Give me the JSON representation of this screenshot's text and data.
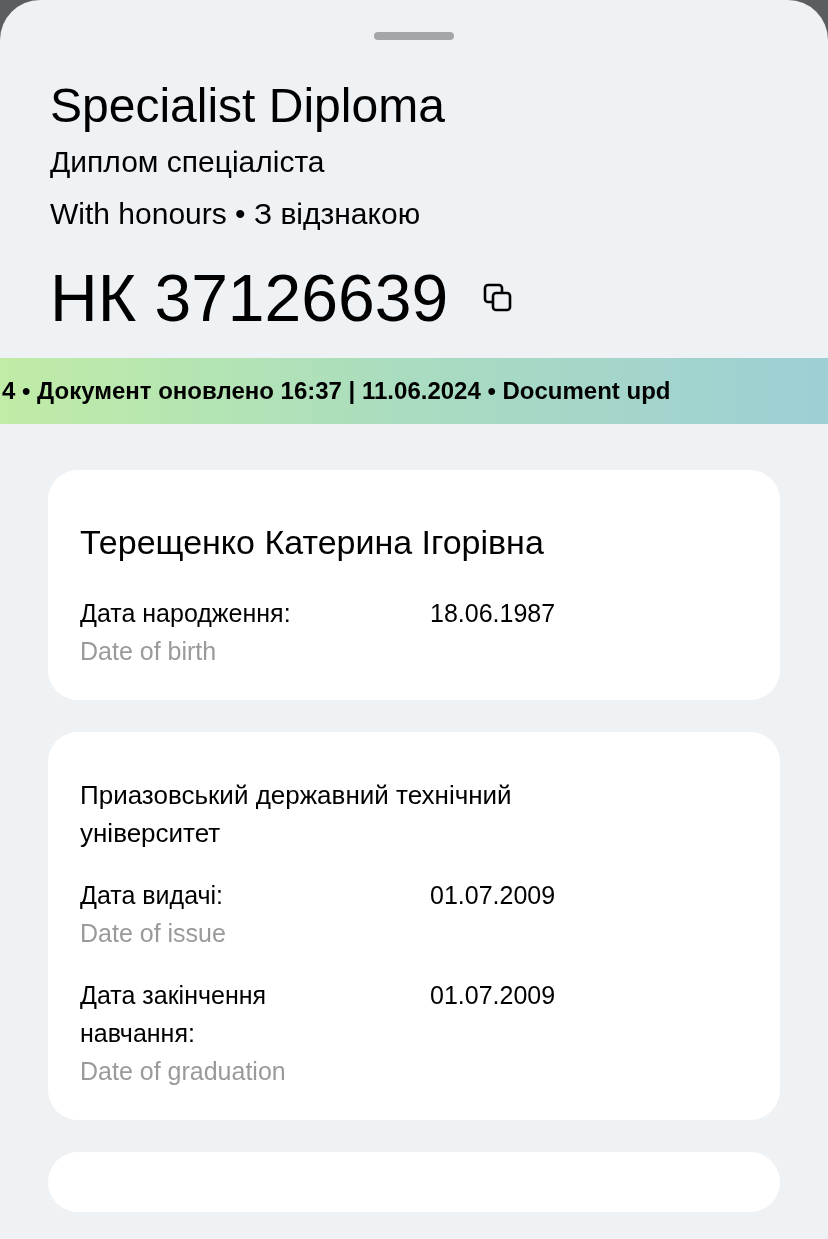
{
  "header": {
    "title": "Specialist Diploma",
    "subtitle": "Диплом спеціаліста",
    "honours": "With honours • З відзнакою",
    "number": "НК 37126639"
  },
  "ticker": {
    "text": "4 • Документ оновлено 16:37 | 11.06.2024 • Document upd"
  },
  "cards": [
    {
      "heading": "Терещенко Катерина Ігорівна",
      "kind": "person",
      "fields": [
        {
          "label": "Дата народження:",
          "label_en": "Date of birth",
          "value": "18.06.1987"
        }
      ]
    },
    {
      "heading": "Приазовський державний технічний університет",
      "kind": "institution",
      "fields": [
        {
          "label": "Дата видачі:",
          "label_en": "Date of issue",
          "value": "01.07.2009"
        },
        {
          "label": "Дата закінчення навчання:",
          "label_en": "Date of graduation",
          "value": "01.07.2009"
        }
      ]
    }
  ]
}
